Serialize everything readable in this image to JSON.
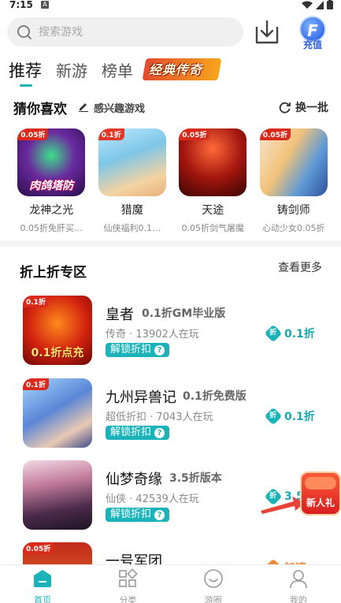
{
  "status_bar": {
    "time": "7:15",
    "notification_icon": "A"
  },
  "search": {
    "placeholder": "搜索游戏"
  },
  "header": {
    "recharge_label": "充值",
    "recharge_badge": "F"
  },
  "tabs": [
    {
      "label": "推荐",
      "active": true
    },
    {
      "label": "新游",
      "active": false
    },
    {
      "label": "榜单",
      "active": false
    }
  ],
  "tab_banner": "经典传奇",
  "guess": {
    "title": "猜你喜欢",
    "subtitle": "感兴趣游戏",
    "refresh_label": "换一批",
    "games": [
      {
        "name": "龙神之光",
        "desc": "0.05折免肝买…",
        "tag": "0.05折",
        "cover_label": "肉鸽塔防"
      },
      {
        "name": "猎魔",
        "desc": "仙侠福利0.1…",
        "tag": "0.1折",
        "cover_label": ""
      },
      {
        "name": "天途",
        "desc": "0.05折剑气屠魔",
        "tag": "0.05折",
        "cover_label": ""
      },
      {
        "name": "铸剑师",
        "desc": "心动少女0.05折",
        "tag": "0.05折",
        "cover_label": ""
      }
    ]
  },
  "section": {
    "title": "折上折专区",
    "more_label": "查看更多",
    "unlock_label": "解锁折扣",
    "games": [
      {
        "name": "皇者",
        "version": "0.1折GM毕业版",
        "meta": "传奇 · 13902人在玩",
        "discount": "0.1折",
        "cover_tag": "0.1折",
        "cover_text": "0.1折点充"
      },
      {
        "name": "九州异兽记",
        "version": "0.1折免费版",
        "meta": "超低折扣 · 7043人在玩",
        "discount": "0.1折",
        "cover_tag": "0.1折"
      },
      {
        "name": "仙梦奇缘",
        "version": "3.5折版本",
        "meta": "仙侠 · 42539人在玩",
        "discount": "3.5",
        "cover_tag": ""
      },
      {
        "name": "一号军团",
        "version": "",
        "meta": "",
        "discount": "加速",
        "cover_tag": "0.05折"
      }
    ]
  },
  "gift": {
    "label": "新人礼"
  },
  "bottom_nav": [
    {
      "label": "首页",
      "active": true
    },
    {
      "label": "分类",
      "active": false
    },
    {
      "label": "游圈",
      "active": false
    },
    {
      "label": "我的",
      "active": false
    }
  ],
  "colors": {
    "accent": "#1ab3b9",
    "text": "#222222",
    "muted": "#888888",
    "badge_red": "#d92a1b"
  }
}
